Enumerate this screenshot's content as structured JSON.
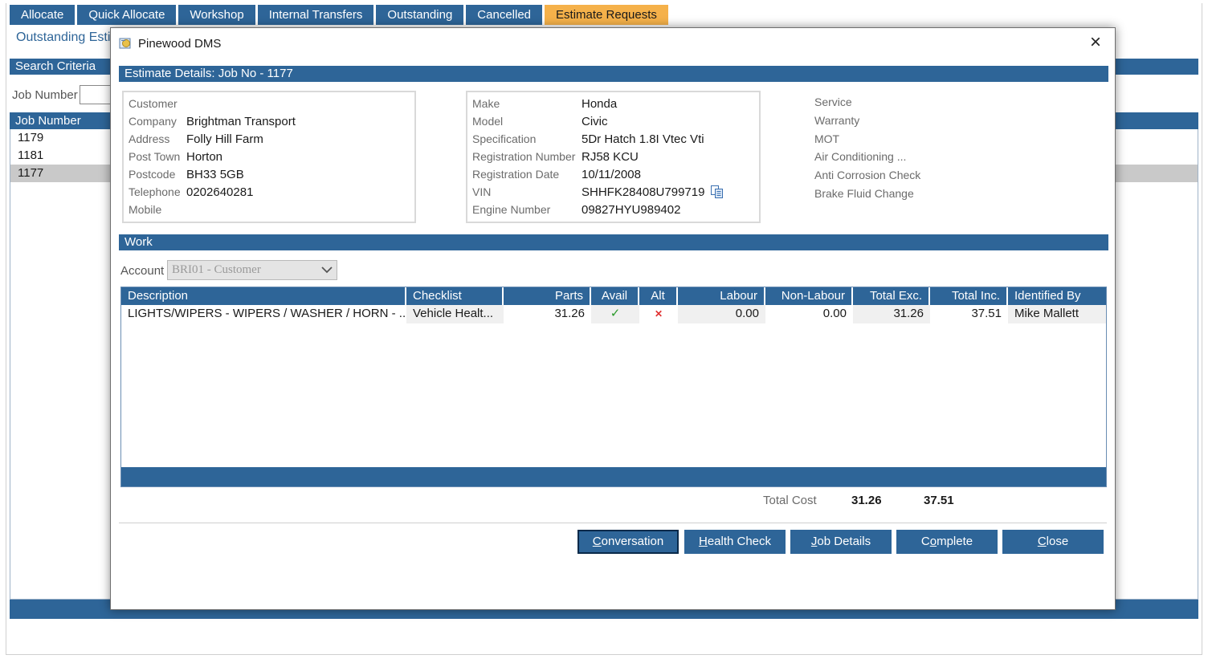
{
  "tabs": [
    {
      "label": "Allocate"
    },
    {
      "label": "Quick Allocate"
    },
    {
      "label": "Workshop"
    },
    {
      "label": "Internal Transfers"
    },
    {
      "label": "Outstanding"
    },
    {
      "label": "Cancelled"
    },
    {
      "label": "Estimate Requests",
      "active": true
    }
  ],
  "background": {
    "page_title": "Outstanding Esti",
    "search_criteria_label": "Search Criteria",
    "job_number_label": "Job Number",
    "job_number_value": "",
    "grid_header": "Job Number",
    "rows": [
      "1179",
      "1181",
      "1177"
    ]
  },
  "modal": {
    "title": "Pinewood DMS",
    "details_header": "Estimate Details: Job No - 1177",
    "customer": {
      "customer_label": "Customer",
      "company_label": "Company",
      "company": "Brightman Transport",
      "address_label": "Address",
      "address": "Folly Hill Farm",
      "post_town_label": "Post Town",
      "post_town": "Horton",
      "postcode_label": "Postcode",
      "postcode": "BH33 5GB",
      "telephone_label": "Telephone",
      "telephone": "0202640281",
      "mobile_label": "Mobile",
      "mobile": ""
    },
    "vehicle": {
      "make_label": "Make",
      "make": "Honda",
      "model_label": "Model",
      "model": "Civic",
      "specification_label": "Specification",
      "specification": "5Dr Hatch 1.8I Vtec Vti",
      "registration_number_label": "Registration Number",
      "registration_number": "RJ58 KCU",
      "registration_date_label": "Registration Date",
      "registration_date": "10/11/2008",
      "vin_label": "VIN",
      "vin": "SHHFK28408U799719",
      "engine_number_label": "Engine Number",
      "engine_number": "09827HYU989402"
    },
    "services": [
      "Service",
      "Warranty",
      "MOT",
      "Air Conditioning ...",
      "Anti Corrosion Check",
      "Brake Fluid Change"
    ],
    "work_header": "Work",
    "account_label": "Account",
    "account_value": "BRI01 - Customer",
    "work_columns": {
      "description": "Description",
      "checklist": "Checklist",
      "parts": "Parts",
      "avail": "Avail",
      "alt": "Alt",
      "labour": "Labour",
      "non_labour": "Non-Labour",
      "total_exc": "Total Exc.",
      "total_inc": "Total Inc.",
      "identified_by": "Identified By"
    },
    "work_rows": [
      {
        "description": "LIGHTS/WIPERS - WIPERS / WASHER / HORN - ...",
        "checklist": "Vehicle Healt...",
        "parts": "31.26",
        "avail_icon": "check-icon",
        "alt_icon": "cross-icon",
        "labour": "0.00",
        "non_labour": "0.00",
        "total_exc": "31.26",
        "total_inc": "37.51",
        "identified_by": "Mike Mallett"
      }
    ],
    "totals": {
      "label": "Total Cost",
      "exc": "31.26",
      "inc": "37.51"
    },
    "buttons": {
      "conversation": {
        "pre": "",
        "u": "C",
        "post": "onversation"
      },
      "health_check": {
        "pre": "",
        "u": "H",
        "post": "ealth Check"
      },
      "job_details": {
        "pre": "",
        "u": "J",
        "post": "ob Details"
      },
      "complete": {
        "pre": "C",
        "u": "o",
        "post": "mplete"
      },
      "close": {
        "pre": "",
        "u": "C",
        "post": "lose"
      }
    }
  },
  "colors": {
    "primary": "#2e6598",
    "active_tab": "#f5b14a",
    "selected_row": "#c9c9c9",
    "check": "#2a9a2a",
    "cross": "#e03030"
  }
}
